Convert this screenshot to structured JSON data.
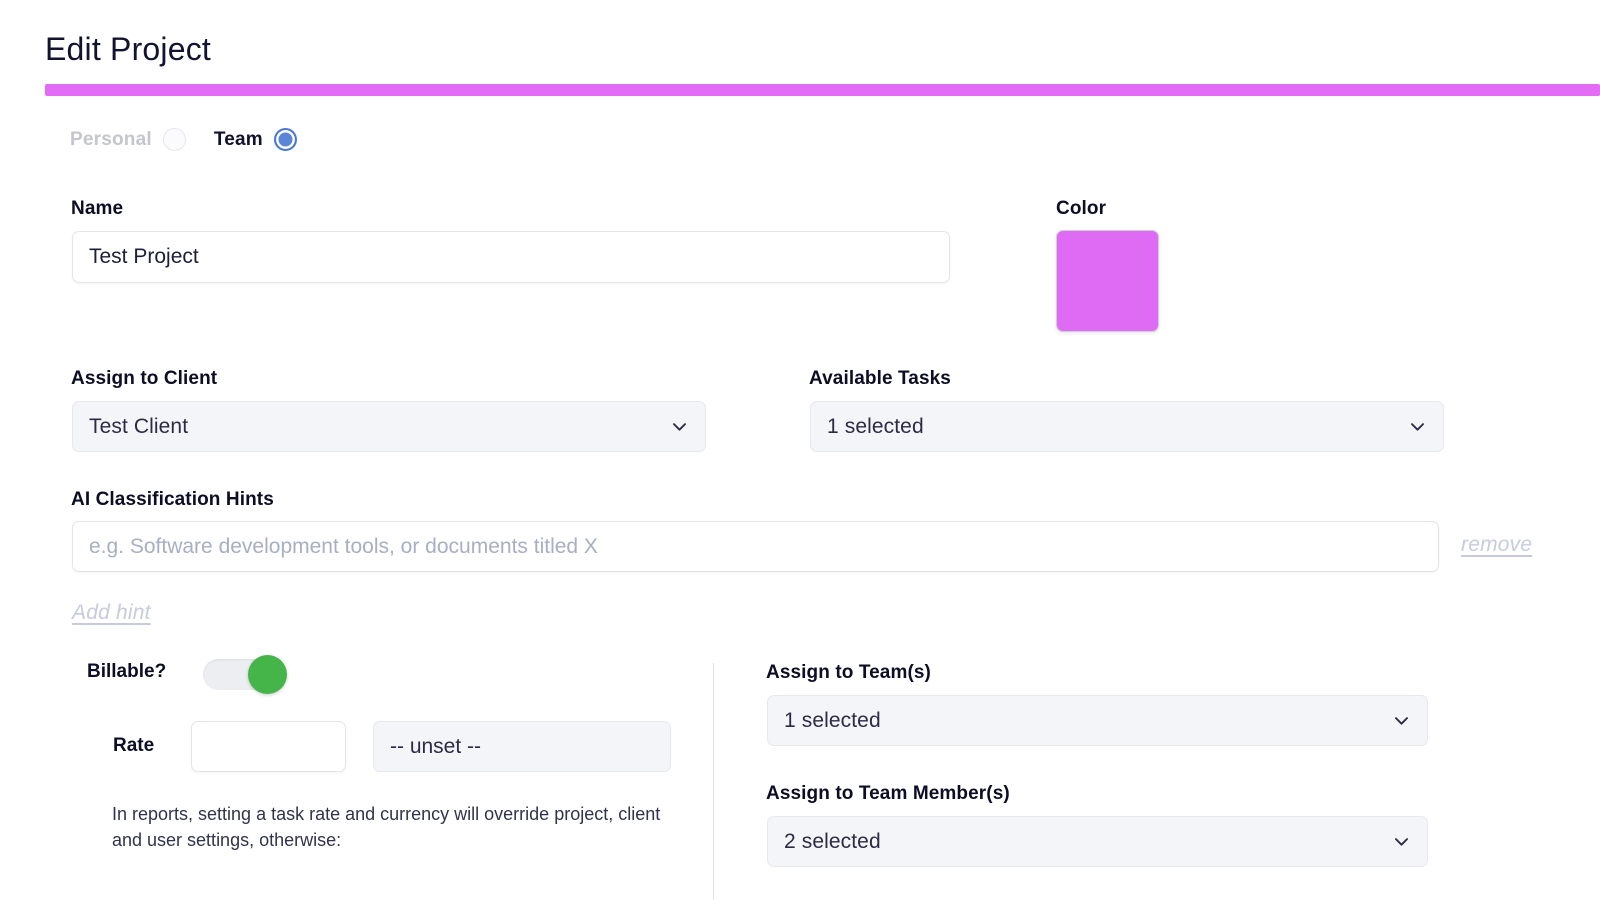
{
  "header": {
    "title": "Edit Project",
    "accent_color": "#e36cf7"
  },
  "project_type": {
    "personal_label": "Personal",
    "team_label": "Team",
    "selected": "Team"
  },
  "name_field": {
    "label": "Name",
    "value": "Test Project"
  },
  "color_field": {
    "label": "Color",
    "value": "#df6bf4"
  },
  "client_field": {
    "label": "Assign to Client",
    "value": "Test Client"
  },
  "tasks_field": {
    "label": "Available Tasks",
    "value": "1 selected"
  },
  "hints": {
    "label": "AI Classification Hints",
    "placeholder": "e.g. Software development tools, or documents titled X",
    "value": "",
    "remove_label": "remove",
    "add_label": "Add hint"
  },
  "billable": {
    "label": "Billable?",
    "enabled": true,
    "toggle_on_color": "#45b54a"
  },
  "rate": {
    "label": "Rate",
    "value": "",
    "currency_value": "-- unset --",
    "help_text": "In reports, setting a task rate and currency will override project, client and user settings, otherwise:"
  },
  "teams_field": {
    "label": "Assign to Team(s)",
    "value": "1 selected"
  },
  "members_field": {
    "label": "Assign to Team Member(s)",
    "value": "2 selected"
  },
  "icons": {
    "chevron": "chevron-down-icon"
  }
}
